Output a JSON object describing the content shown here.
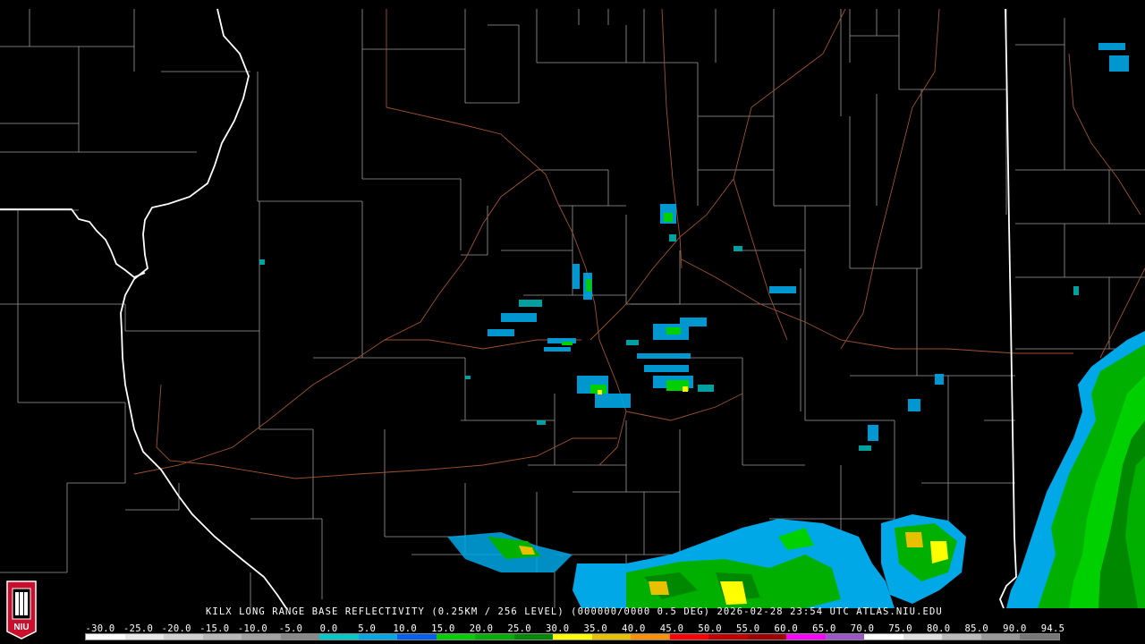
{
  "caption": "KILX LONG RANGE BASE REFLECTIVITY (0.25KM / 256 LEVEL) (000000/0000 0.5 DEG) 2026-02-28 23:54 UTC  ATLAS.NIU.EDU",
  "logo_text": "NIU",
  "scale_labels": [
    "-30.0",
    "-25.0",
    "-20.0",
    "-15.0",
    "-10.0",
    "-5.0",
    "0.0",
    "5.0",
    "10.0",
    "15.0",
    "20.0",
    "25.0",
    "30.0",
    "35.0",
    "40.0",
    "45.0",
    "50.0",
    "55.0",
    "60.0",
    "65.0",
    "70.0",
    "75.0",
    "80.0",
    "85.0",
    "90.0",
    "94.5"
  ],
  "colors": {
    "background": "#000000",
    "state_border": "#ffffff",
    "county_line": "#9a9a9a",
    "highway": "#a0522d",
    "scale": [
      "#ffffff",
      "#e8e8e8",
      "#d0d0d0",
      "#b8b8b8",
      "#a0a0a0",
      "#888888",
      "#00c8c8",
      "#00a8e8",
      "#0060f0",
      "#00d000",
      "#00b000",
      "#008800",
      "#ffff00",
      "#e8c000",
      "#ff9000",
      "#ff0000",
      "#c00000",
      "#a00000",
      "#ff00ff",
      "#9a55c9",
      "#ffffff",
      "#e0e0e0",
      "#bbbbbb",
      "#999999",
      "#777777"
    ]
  }
}
